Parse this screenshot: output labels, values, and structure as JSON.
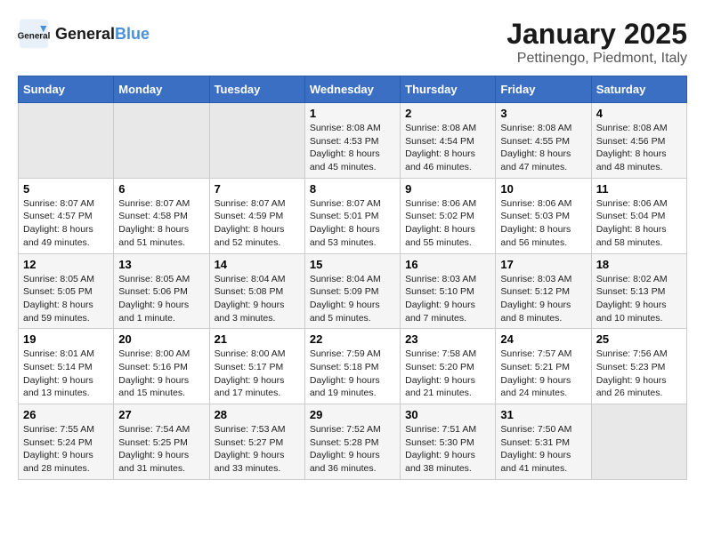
{
  "logo": {
    "text_general": "General",
    "text_blue": "Blue"
  },
  "title": "January 2025",
  "location": "Pettinengo, Piedmont, Italy",
  "weekdays": [
    "Sunday",
    "Monday",
    "Tuesday",
    "Wednesday",
    "Thursday",
    "Friday",
    "Saturday"
  ],
  "weeks": [
    [
      {
        "day": null
      },
      {
        "day": null
      },
      {
        "day": null
      },
      {
        "day": "1",
        "sunrise": "Sunrise: 8:08 AM",
        "sunset": "Sunset: 4:53 PM",
        "daylight": "Daylight: 8 hours and 45 minutes."
      },
      {
        "day": "2",
        "sunrise": "Sunrise: 8:08 AM",
        "sunset": "Sunset: 4:54 PM",
        "daylight": "Daylight: 8 hours and 46 minutes."
      },
      {
        "day": "3",
        "sunrise": "Sunrise: 8:08 AM",
        "sunset": "Sunset: 4:55 PM",
        "daylight": "Daylight: 8 hours and 47 minutes."
      },
      {
        "day": "4",
        "sunrise": "Sunrise: 8:08 AM",
        "sunset": "Sunset: 4:56 PM",
        "daylight": "Daylight: 8 hours and 48 minutes."
      }
    ],
    [
      {
        "day": "5",
        "sunrise": "Sunrise: 8:07 AM",
        "sunset": "Sunset: 4:57 PM",
        "daylight": "Daylight: 8 hours and 49 minutes."
      },
      {
        "day": "6",
        "sunrise": "Sunrise: 8:07 AM",
        "sunset": "Sunset: 4:58 PM",
        "daylight": "Daylight: 8 hours and 51 minutes."
      },
      {
        "day": "7",
        "sunrise": "Sunrise: 8:07 AM",
        "sunset": "Sunset: 4:59 PM",
        "daylight": "Daylight: 8 hours and 52 minutes."
      },
      {
        "day": "8",
        "sunrise": "Sunrise: 8:07 AM",
        "sunset": "Sunset: 5:01 PM",
        "daylight": "Daylight: 8 hours and 53 minutes."
      },
      {
        "day": "9",
        "sunrise": "Sunrise: 8:06 AM",
        "sunset": "Sunset: 5:02 PM",
        "daylight": "Daylight: 8 hours and 55 minutes."
      },
      {
        "day": "10",
        "sunrise": "Sunrise: 8:06 AM",
        "sunset": "Sunset: 5:03 PM",
        "daylight": "Daylight: 8 hours and 56 minutes."
      },
      {
        "day": "11",
        "sunrise": "Sunrise: 8:06 AM",
        "sunset": "Sunset: 5:04 PM",
        "daylight": "Daylight: 8 hours and 58 minutes."
      }
    ],
    [
      {
        "day": "12",
        "sunrise": "Sunrise: 8:05 AM",
        "sunset": "Sunset: 5:05 PM",
        "daylight": "Daylight: 8 hours and 59 minutes."
      },
      {
        "day": "13",
        "sunrise": "Sunrise: 8:05 AM",
        "sunset": "Sunset: 5:06 PM",
        "daylight": "Daylight: 9 hours and 1 minute."
      },
      {
        "day": "14",
        "sunrise": "Sunrise: 8:04 AM",
        "sunset": "Sunset: 5:08 PM",
        "daylight": "Daylight: 9 hours and 3 minutes."
      },
      {
        "day": "15",
        "sunrise": "Sunrise: 8:04 AM",
        "sunset": "Sunset: 5:09 PM",
        "daylight": "Daylight: 9 hours and 5 minutes."
      },
      {
        "day": "16",
        "sunrise": "Sunrise: 8:03 AM",
        "sunset": "Sunset: 5:10 PM",
        "daylight": "Daylight: 9 hours and 7 minutes."
      },
      {
        "day": "17",
        "sunrise": "Sunrise: 8:03 AM",
        "sunset": "Sunset: 5:12 PM",
        "daylight": "Daylight: 9 hours and 8 minutes."
      },
      {
        "day": "18",
        "sunrise": "Sunrise: 8:02 AM",
        "sunset": "Sunset: 5:13 PM",
        "daylight": "Daylight: 9 hours and 10 minutes."
      }
    ],
    [
      {
        "day": "19",
        "sunrise": "Sunrise: 8:01 AM",
        "sunset": "Sunset: 5:14 PM",
        "daylight": "Daylight: 9 hours and 13 minutes."
      },
      {
        "day": "20",
        "sunrise": "Sunrise: 8:00 AM",
        "sunset": "Sunset: 5:16 PM",
        "daylight": "Daylight: 9 hours and 15 minutes."
      },
      {
        "day": "21",
        "sunrise": "Sunrise: 8:00 AM",
        "sunset": "Sunset: 5:17 PM",
        "daylight": "Daylight: 9 hours and 17 minutes."
      },
      {
        "day": "22",
        "sunrise": "Sunrise: 7:59 AM",
        "sunset": "Sunset: 5:18 PM",
        "daylight": "Daylight: 9 hours and 19 minutes."
      },
      {
        "day": "23",
        "sunrise": "Sunrise: 7:58 AM",
        "sunset": "Sunset: 5:20 PM",
        "daylight": "Daylight: 9 hours and 21 minutes."
      },
      {
        "day": "24",
        "sunrise": "Sunrise: 7:57 AM",
        "sunset": "Sunset: 5:21 PM",
        "daylight": "Daylight: 9 hours and 24 minutes."
      },
      {
        "day": "25",
        "sunrise": "Sunrise: 7:56 AM",
        "sunset": "Sunset: 5:23 PM",
        "daylight": "Daylight: 9 hours and 26 minutes."
      }
    ],
    [
      {
        "day": "26",
        "sunrise": "Sunrise: 7:55 AM",
        "sunset": "Sunset: 5:24 PM",
        "daylight": "Daylight: 9 hours and 28 minutes."
      },
      {
        "day": "27",
        "sunrise": "Sunrise: 7:54 AM",
        "sunset": "Sunset: 5:25 PM",
        "daylight": "Daylight: 9 hours and 31 minutes."
      },
      {
        "day": "28",
        "sunrise": "Sunrise: 7:53 AM",
        "sunset": "Sunset: 5:27 PM",
        "daylight": "Daylight: 9 hours and 33 minutes."
      },
      {
        "day": "29",
        "sunrise": "Sunrise: 7:52 AM",
        "sunset": "Sunset: 5:28 PM",
        "daylight": "Daylight: 9 hours and 36 minutes."
      },
      {
        "day": "30",
        "sunrise": "Sunrise: 7:51 AM",
        "sunset": "Sunset: 5:30 PM",
        "daylight": "Daylight: 9 hours and 38 minutes."
      },
      {
        "day": "31",
        "sunrise": "Sunrise: 7:50 AM",
        "sunset": "Sunset: 5:31 PM",
        "daylight": "Daylight: 9 hours and 41 minutes."
      },
      {
        "day": null
      }
    ]
  ]
}
